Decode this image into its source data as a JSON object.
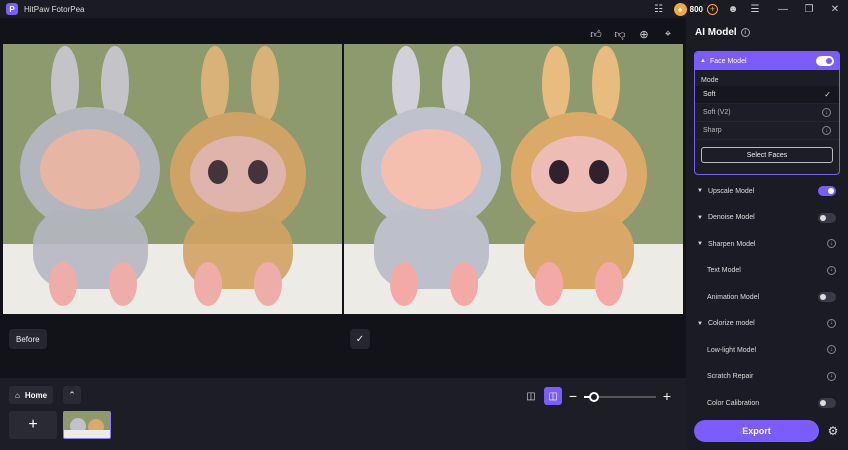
{
  "titlebar": {
    "app_title": "HitPaw FotorPea",
    "logo_letter": "P",
    "coin_count": "800",
    "icons": [
      "gamepad-icon",
      "coin-icon",
      "add-coins-icon",
      "account-icon",
      "menu-icon"
    ],
    "window_controls": [
      "minimize-icon",
      "restore-icon",
      "close-icon"
    ]
  },
  "toolbar": {
    "icons": [
      "thumbs-up-icon",
      "thumbs-down-icon",
      "zoom-in-icon",
      "crop-icon"
    ]
  },
  "preview": {
    "before_label": "Before",
    "after_icon": "check-icon"
  },
  "bottom": {
    "home_label": "Home",
    "zoom_level": 0.14
  },
  "sidebar": {
    "title": "AI Model",
    "face_model": {
      "label": "Face Model",
      "enabled": true,
      "mode_label": "Mode",
      "options": [
        {
          "label": "Soft",
          "status": "selected"
        },
        {
          "label": "Soft (V2)",
          "status": "download"
        },
        {
          "label": "Sharp",
          "status": "download"
        }
      ],
      "select_faces_label": "Select Faces"
    },
    "models": [
      {
        "label": "Upscale Model",
        "arrow": true,
        "control": "toggle-on"
      },
      {
        "label": "Denoise Model",
        "arrow": true,
        "control": "toggle-off"
      },
      {
        "label": "Sharpen Model",
        "arrow": true,
        "control": "download"
      },
      {
        "label": "Text Model",
        "arrow": false,
        "control": "download"
      },
      {
        "label": "Animation Model",
        "arrow": false,
        "control": "toggle-off"
      },
      {
        "label": "Colorize model",
        "arrow": true,
        "control": "download"
      },
      {
        "label": "Low-light Model",
        "arrow": false,
        "control": "download"
      },
      {
        "label": "Scratch Repair",
        "arrow": false,
        "control": "download"
      },
      {
        "label": "Color Calibration",
        "arrow": false,
        "control": "toggle-off"
      }
    ],
    "export_label": "Export"
  },
  "colors": {
    "accent": "#7b5cff",
    "background": "#15151d",
    "panel": "#1b1b23",
    "photo_wall": "#8c9a6d",
    "photo_floor": "#ecebe6"
  }
}
